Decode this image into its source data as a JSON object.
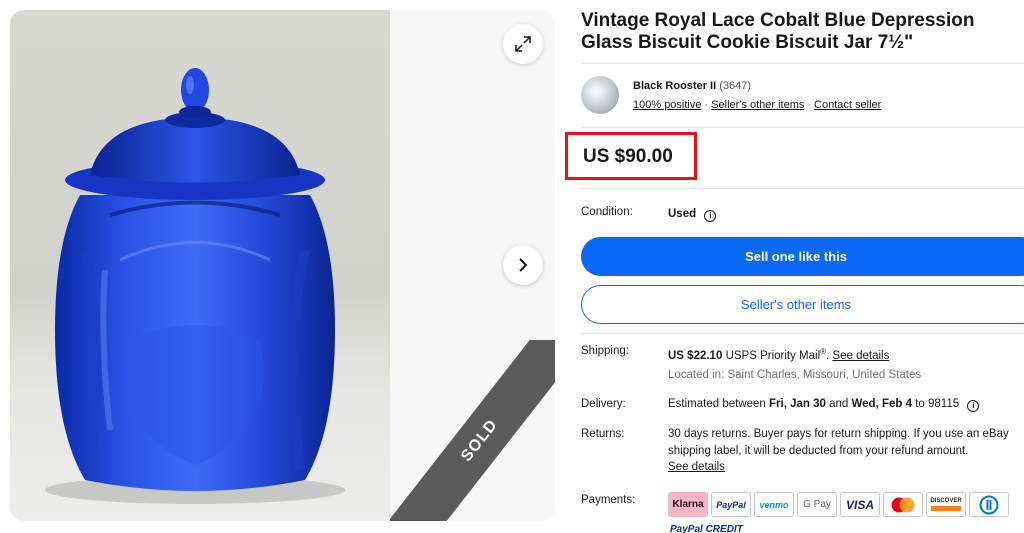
{
  "listing": {
    "title": "Vintage Royal Lace Cobalt Blue Depression Glass Biscuit Cookie Biscuit Jar 7½\"",
    "price": "US $90.00",
    "sold_label": "SOLD"
  },
  "seller": {
    "name": "Black Rooster II",
    "feedback_count": "(3647)",
    "positive": "100% positive",
    "other_items": "Seller's other items",
    "contact": "Contact seller",
    "separator": "·"
  },
  "condition": {
    "label": "Condition:",
    "value": "Used"
  },
  "buttons": {
    "primary": "Sell one like this",
    "secondary": "Seller's other items"
  },
  "shipping": {
    "label": "Shipping:",
    "cost": "US $22.10",
    "service": "USPS Priority Mail",
    "registered": "®",
    "details_link": "See details",
    "location": "Located in: Saint Charles, Missouri, United States"
  },
  "delivery": {
    "label": "Delivery:",
    "prefix": "Estimated between",
    "start": "Fri, Jan 30",
    "and": "and",
    "end": "Wed, Feb 4",
    "to": "to 98115"
  },
  "returns": {
    "label": "Returns:",
    "text": "30 days returns. Buyer pays for return shipping. If you use an eBay shipping label, it will be deducted from your refund amount.",
    "details_link": "See details"
  },
  "payments": {
    "label": "Payments:",
    "methods": [
      "Klarna",
      "PayPal",
      "venmo",
      "G Pay",
      "VISA",
      "Mastercard",
      "DISCOVER",
      "Diners Club"
    ],
    "paypal_credit": "PayPal CREDIT"
  },
  "colors": {
    "primary_blue": "#0968f6",
    "highlight_red": "#e0141a",
    "sold_gray": "#5b5b5b"
  },
  "icons": [
    "expand-icon",
    "chevron-right-icon",
    "info-icon"
  ]
}
